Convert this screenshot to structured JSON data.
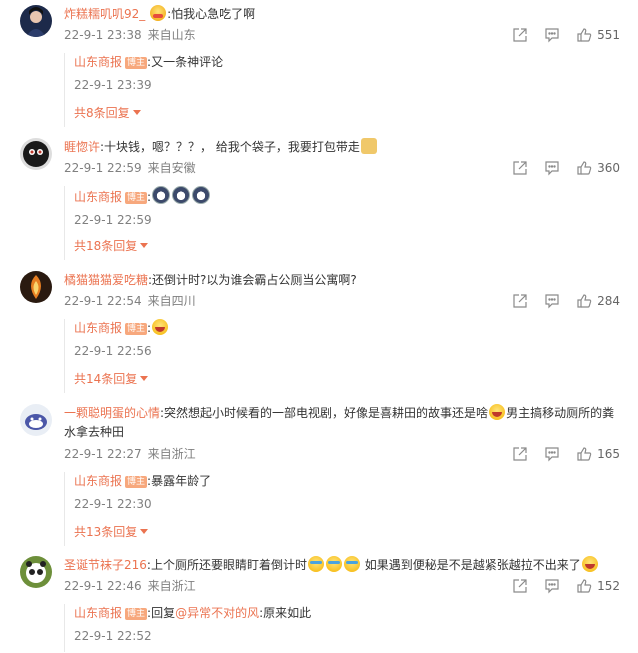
{
  "comments": [
    {
      "user": "炸糕糯叽叽92_",
      "text": ":怕我心急吃了啊",
      "time": "22-9-1 23:38",
      "location": "来自山东",
      "likes": "551",
      "reply": {
        "user": "山东商报",
        "badge": "博主",
        "text": ":又一条神评论",
        "time": "22-9-1 23:39"
      },
      "more": "共8条回复"
    },
    {
      "user": "睚惚许",
      "text": ":十块钱，嗯？？？， 给我个袋子，我要打包带走",
      "time": "22-9-1 22:59",
      "location": "来自安徽",
      "likes": "360",
      "reply": {
        "user": "山东商报",
        "badge": "博主",
        "text": ":",
        "time": "22-9-1 22:59"
      },
      "more": "共18条回复"
    },
    {
      "user": "橘猫猫猫爱吃糖",
      "text": ":还倒计时?以为谁会霸占公厕当公寓啊?",
      "time": "22-9-1 22:54",
      "location": "来自四川",
      "likes": "284",
      "reply": {
        "user": "山东商报",
        "badge": "博主",
        "text": ":",
        "time": "22-9-1 22:56"
      },
      "more": "共14条回复"
    },
    {
      "user": "一颗聪明蛋的心情",
      "text": ":突然想起小时候看的一部电视剧，好像是喜耕田的故事还是啥",
      "text2": "男主搞移动厕所的粪",
      "text3": "水拿去种田",
      "time": "22-9-1 22:27",
      "location": "来自浙江",
      "likes": "165",
      "reply": {
        "user": "山东商报",
        "badge": "博主",
        "text": ":暴露年龄了",
        "time": "22-9-1 22:30"
      },
      "more": "共13条回复"
    },
    {
      "user": "圣诞节袜子216",
      "text": ":上个厕所还要眼睛盯着倒计时",
      "text2": " 如果遇到便秘是不是越紧张越拉不出来了",
      "time": "22-9-1 22:46",
      "location": "来自浙江",
      "likes": "152",
      "reply": {
        "user": "山东商报",
        "badge": "博主",
        "text_pre": ":回复",
        "mention": "@异常不对的风",
        "text_post": ":原来如此",
        "time": "22-9-1 22:52"
      }
    }
  ]
}
